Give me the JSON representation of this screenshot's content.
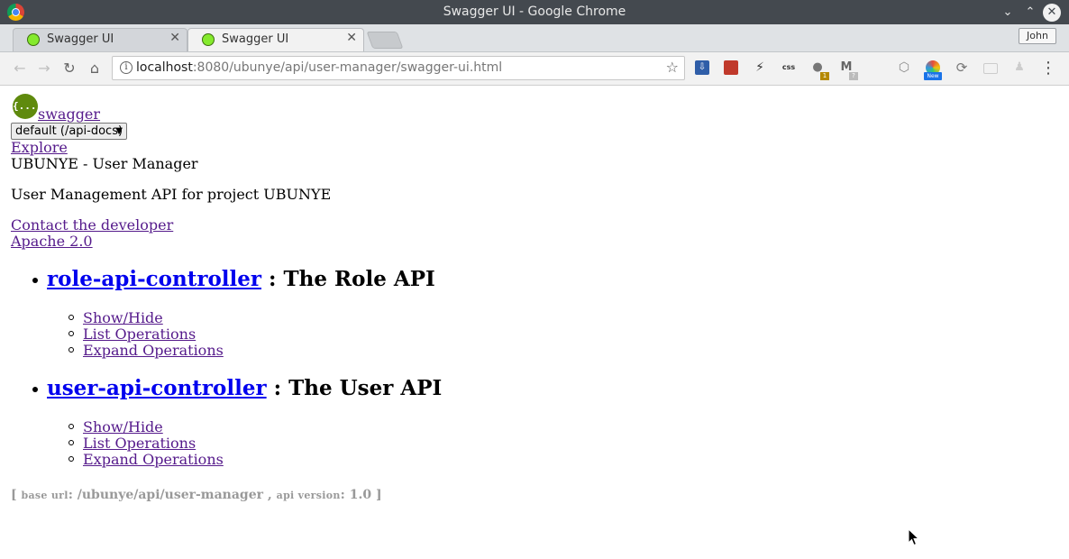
{
  "window": {
    "title": "Swagger UI - Google Chrome"
  },
  "tabs": [
    {
      "label": "Swagger UI",
      "active": false
    },
    {
      "label": "Swagger UI",
      "active": true
    }
  ],
  "profile": {
    "name": "John"
  },
  "omnibox": {
    "host": "localhost",
    "path": ":8080/ubunye/api/user-manager/swagger-ui.html"
  },
  "extensions": {
    "new_badge": "New",
    "badge_1": "1",
    "badge_2": "?"
  },
  "swagger": {
    "logo_text": "{...}",
    "brand_link": "swagger",
    "spec_select": "default (/api-docs)",
    "explore_link": "Explore",
    "api_title": "UBUNYE - User Manager",
    "api_description": "User Management API for project UBUNYE",
    "contact_link": "Contact the developer",
    "license_link": "Apache 2.0"
  },
  "controllers": [
    {
      "name": "role-api-controller",
      "description": ": The Role API",
      "actions": [
        "Show/Hide",
        "List Operations",
        "Expand Operations"
      ]
    },
    {
      "name": "user-api-controller",
      "description": ": The User API",
      "actions": [
        "Show/Hide",
        "List Operations",
        "Expand Operations"
      ]
    }
  ],
  "footer": {
    "open": "[",
    "base_url_label": "base url",
    "base_url": ": /ubunye/api/user-manager ,",
    "api_version_label": "api version",
    "api_version": ": 1.0 ]"
  },
  "colors": {
    "titlebar": "#44494f",
    "link_visited": "#551a8b",
    "link": "#0000ee",
    "footer_text": "#999999",
    "swagger_green": "#5f8a0d"
  }
}
